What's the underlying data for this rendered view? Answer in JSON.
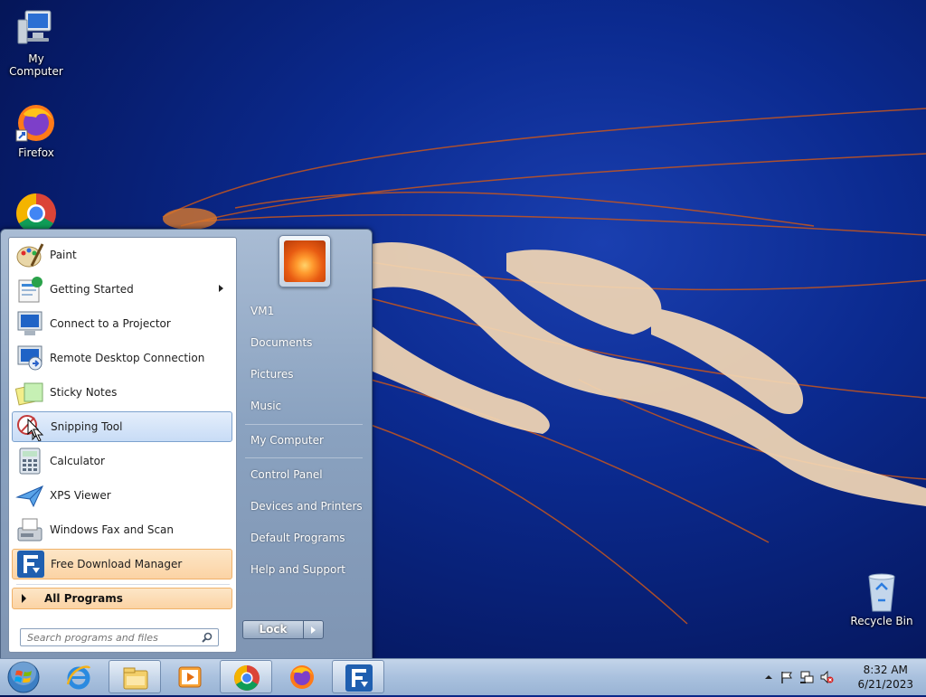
{
  "desktop": {
    "icons": [
      {
        "label": "My Computer",
        "icon": "my-computer-icon"
      },
      {
        "label": "Firefox",
        "icon": "firefox-icon"
      },
      {
        "label": "",
        "icon": "chrome-icon"
      },
      {
        "label": "Recycle Bin",
        "icon": "recycle-bin-icon"
      }
    ]
  },
  "start_menu": {
    "programs": [
      {
        "label": "Paint",
        "icon": "paint-icon"
      },
      {
        "label": "Getting Started",
        "icon": "getting-started-icon",
        "submenu": true
      },
      {
        "label": "Connect to a Projector",
        "icon": "projector-icon"
      },
      {
        "label": "Remote Desktop Connection",
        "icon": "remote-desktop-icon"
      },
      {
        "label": "Sticky Notes",
        "icon": "sticky-notes-icon"
      },
      {
        "label": "Snipping Tool",
        "icon": "snipping-tool-icon",
        "highlighted": true
      },
      {
        "label": "Calculator",
        "icon": "calculator-icon"
      },
      {
        "label": "XPS Viewer",
        "icon": "xps-viewer-icon"
      },
      {
        "label": "Windows Fax and Scan",
        "icon": "fax-scan-icon"
      },
      {
        "label": "Free Download Manager",
        "icon": "fdm-icon",
        "pinned_new": true
      }
    ],
    "all_programs": "All Programs",
    "search_placeholder": "Search programs and files",
    "right_items": [
      "VM1",
      "Documents",
      "Pictures",
      "Music",
      "My Computer",
      "Control Panel",
      "Devices and Printers",
      "Default Programs",
      "Help and Support"
    ],
    "lock_label": "Lock"
  },
  "taskbar": {
    "pinned": [
      "internet-explorer-icon",
      "file-explorer-icon",
      "media-player-icon",
      "chrome-icon",
      "firefox-icon",
      "fdm-icon"
    ],
    "clock_time": "8:32 AM",
    "clock_date": "6/21/2023"
  },
  "colors": {
    "wallpaper": "#0b2a8f",
    "start_menu": "#8aa2c0",
    "taskbar": "#a9c1de",
    "highlight_orange": "#fbd3a4"
  }
}
